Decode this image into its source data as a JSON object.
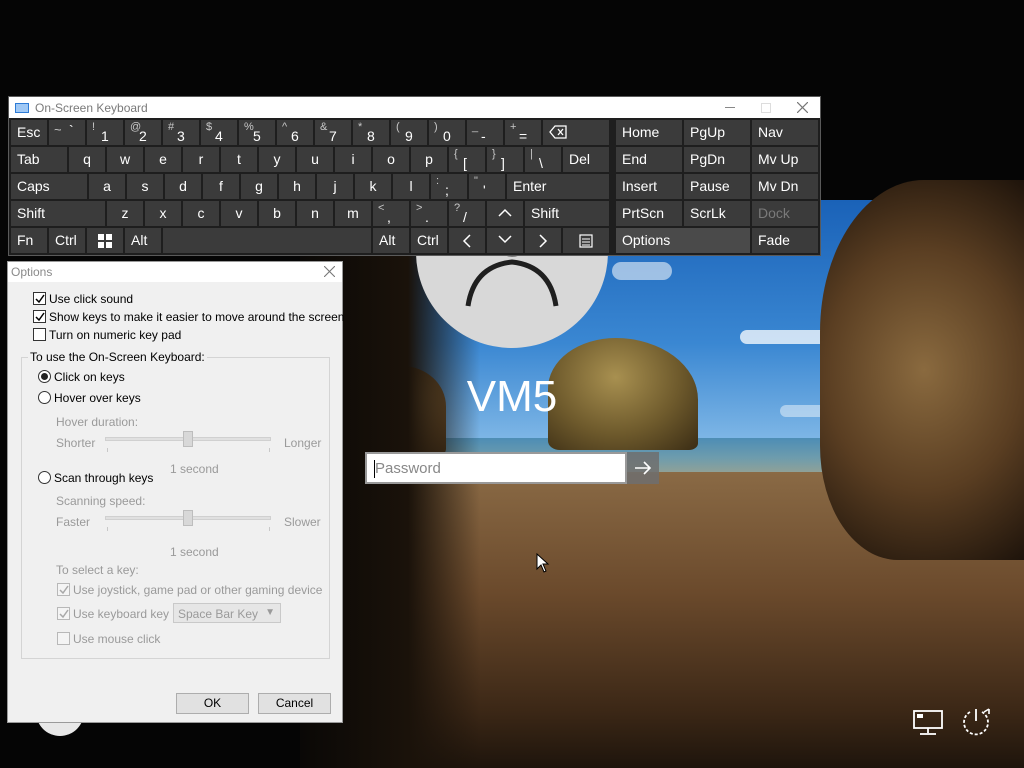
{
  "lockscreen": {
    "username": "VM5",
    "password_placeholder": "Password"
  },
  "osk": {
    "title": "On-Screen Keyboard",
    "keys": {
      "esc": "Esc",
      "tilde_top": "~",
      "tilde_main": "`",
      "n1_top": "!",
      "n1": "1",
      "n2_top": "@",
      "n2": "2",
      "n3_top": "#",
      "n3": "3",
      "n4_top": "$",
      "n4": "4",
      "n5_top": "%",
      "n5": "5",
      "n6_top": "^",
      "n6": "6",
      "n7_top": "&",
      "n7": "7",
      "n8_top": "*",
      "n8": "8",
      "n9_top": "(",
      "n9": "9",
      "n0_top": ")",
      "n0": "0",
      "minus_top": "_",
      "minus": "-",
      "plus_top": "+",
      "equals": "=",
      "tab": "Tab",
      "q": "q",
      "w": "w",
      "e": "e",
      "r": "r",
      "t": "t",
      "y": "y",
      "u": "u",
      "i": "i",
      "o": "o",
      "p": "p",
      "lbrace_top": "{",
      "lbracket": "[",
      "rbrace_top": "}",
      "rbracket": "]",
      "pipe_top": "|",
      "backslash": "\\",
      "del": "Del",
      "caps": "Caps",
      "a": "a",
      "s": "s",
      "d": "d",
      "f": "f",
      "g": "g",
      "h": "h",
      "j": "j",
      "k": "k",
      "l": "l",
      "colon_top": ":",
      "semicolon": ";",
      "quote_top": "\"",
      "apostrophe": "'",
      "enter": "Enter",
      "shift": "Shift",
      "z": "z",
      "x": "x",
      "c": "c",
      "v": "v",
      "b": "b",
      "n": "n",
      "m": "m",
      "lt_top": "<",
      "comma": ",",
      "gt_top": ">",
      "period": ".",
      "question_top": "?",
      "slash": "/",
      "shift_right": "Shift",
      "fn": "Fn",
      "ctrl": "Ctrl",
      "alt": "Alt",
      "alt_right": "Alt",
      "ctrl_right": "Ctrl",
      "home": "Home",
      "pgup": "PgUp",
      "nav": "Nav",
      "end": "End",
      "pgdn": "PgDn",
      "mvup": "Mv Up",
      "insert": "Insert",
      "pause": "Pause",
      "mvdn": "Mv Dn",
      "prtscn": "PrtScn",
      "scrlk": "ScrLk",
      "dock": "Dock",
      "options": "Options",
      "fade": "Fade"
    }
  },
  "options": {
    "title": "Options",
    "use_click_sound": "Use click sound",
    "show_keys_move": "Show keys to make it easier to move around the screen",
    "numeric_keypad": "Turn on numeric key pad",
    "group_label": "To use the On-Screen Keyboard:",
    "click_on_keys": "Click on keys",
    "hover_over_keys": "Hover over keys",
    "hover_duration": "Hover duration:",
    "shorter": "Shorter",
    "longer": "Longer",
    "hover_value": "1 second",
    "scan_through_keys": "Scan through keys",
    "scanning_speed": "Scanning speed:",
    "faster": "Faster",
    "slower": "Slower",
    "scan_value": "1 second",
    "select_key_label": "To select a key:",
    "use_joystick": "Use joystick, game pad or other gaming device",
    "use_keyboard_key": "Use keyboard key",
    "keyboard_key_value": "Space Bar Key",
    "use_mouse_click": "Use mouse click",
    "ok": "OK",
    "cancel": "Cancel",
    "state": {
      "use_click_sound": true,
      "show_keys_move": true,
      "numeric_keypad": false,
      "mode": "click_on_keys",
      "use_joystick": true,
      "use_keyboard_key": true,
      "use_mouse_click": false,
      "hover_level": 0.5,
      "scan_level": 0.5
    }
  },
  "colors": {
    "keyboard_bg": "#1e1e1e",
    "key_bg": "#3b3b3b",
    "dialog_bg": "#f0f0f0"
  }
}
